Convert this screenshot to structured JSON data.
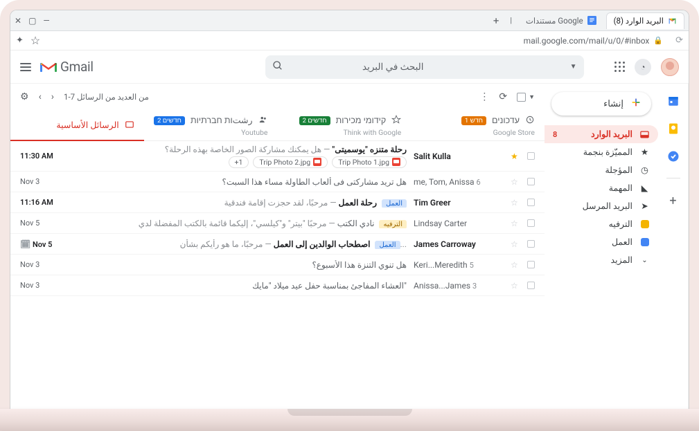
{
  "browser": {
    "tabs": {
      "inactive_title": "مستندات Google",
      "active_title": "البريد الوارد (8)"
    },
    "url": "mail.google.com/mail/u/0/#inbox"
  },
  "header": {
    "brand": "Gmail",
    "search_placeholder": "البحث في البريد"
  },
  "compose": {
    "label": "إنشاء"
  },
  "sidebar": {
    "items": [
      {
        "label": "البريد الوارد",
        "count": "8"
      },
      {
        "label": "المميّزة بنجمة"
      },
      {
        "label": "المؤجلة"
      },
      {
        "label": "المهمة"
      },
      {
        "label": "البريد المرسل"
      },
      {
        "label": "الترفيه"
      },
      {
        "label": "العمل"
      },
      {
        "label": "المزيد"
      }
    ]
  },
  "toolbar": {
    "page_info": "1-7 من العديد من الرسائل"
  },
  "categories": [
    {
      "title": "الرسائل الأساسية"
    },
    {
      "title": "رشتות חברתיות",
      "badge": "2 חדשים",
      "sub": "Youtube"
    },
    {
      "title": "קידומי מכירות",
      "badge": "2 חדשים",
      "sub": "Think with Google"
    },
    {
      "title": "עדכונים",
      "badge": "1 חדש",
      "sub": "Google Store"
    }
  ],
  "rows": [
    {
      "sender": "Salit Kulla",
      "star": true,
      "unread": true,
      "subject": "رحلة متنزه \"يوسميتى\"",
      "snippet": " — هل يمكنك مشاركة الصور الخاصة بهذه الرحلة؟",
      "date": "11:30 AM",
      "attachments": [
        "Trip Photo 1.jpg",
        "Trip Photo 2.jpg"
      ],
      "more": "+1"
    },
    {
      "sender": "me, Tom, Anissa",
      "count": "6",
      "unread": false,
      "subject": "هل تريد مشاركتى فى ألعاب الطاولة مساء هذا السبت؟",
      "date": "Nov 3"
    },
    {
      "sender": "Tim Greer",
      "unread": true,
      "tag": {
        "cls": "work",
        "label": "العمل"
      },
      "subject": "رحلة العمل",
      "snippet": " — مرحبًا، لقد حجزت إقامة فندقية",
      "date": "11:16 AM"
    },
    {
      "sender": "Lindsay Carter",
      "unread": false,
      "tag": {
        "cls": "ent",
        "label": "الترفيه"
      },
      "subject": "نادي الكتب",
      "snippet": " — مرحبًا \"بيتر\" و\"كيلسي\"، إليكما قائمة بالكتب المفضلة لدي",
      "date": "Nov 5"
    },
    {
      "sender": "James Carroway",
      "unread": true,
      "tag": {
        "cls": "work",
        "label": "العمل"
      },
      "subject": "اصطحاب الوالدين إلى العمل",
      "snippet": " — مرحبًا، ما هو رأيكم بشأن...",
      "date": "Nov 5",
      "cal": true
    },
    {
      "sender": "Keri...Meredith",
      "count": "5",
      "unread": false,
      "subject": "هل تنوي التنزة هذا الأسبوع؟",
      "date": "Nov 3"
    },
    {
      "sender": "Anissa...James",
      "count": "3",
      "unread": false,
      "subject": "العشاء المفاجئ بمناسبة حفل عيد ميلاد \"مايك\"",
      "date": "Nov 3"
    }
  ]
}
